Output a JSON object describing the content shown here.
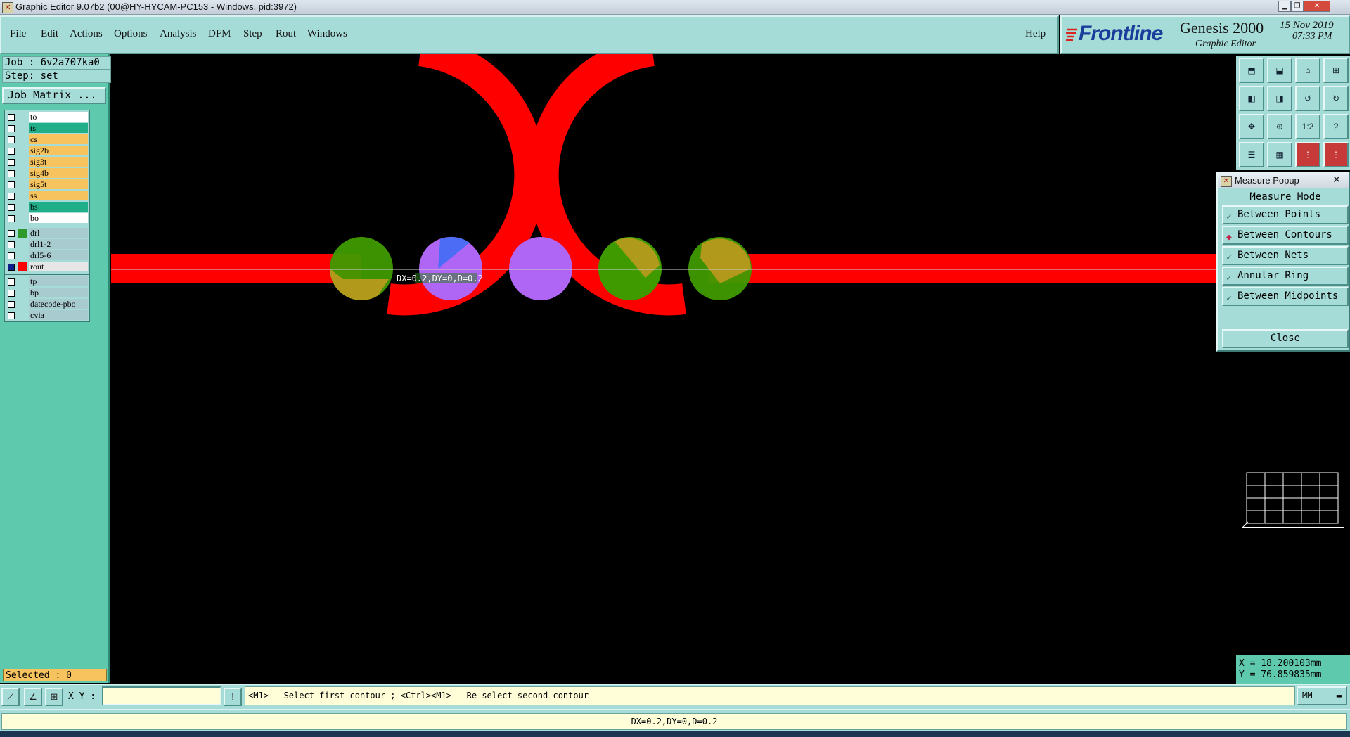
{
  "window": {
    "title": "Graphic Editor 9.07b2 (00@HY-HYCAM-PC153 - Windows, pid:3972)"
  },
  "menu": [
    "File",
    "Edit",
    "Actions",
    "Options",
    "Analysis",
    "DFM",
    "Step",
    "Rout",
    "Windows"
  ],
  "help_label": "Help",
  "brand": {
    "logo": "Frontline",
    "product": "Genesis 2000",
    "subtitle": "Graphic Editor",
    "date": "15 Nov 2019",
    "time": "07:33 PM"
  },
  "job": {
    "job_line": "Job : 6v2a707ka0",
    "step_line": "Step: set",
    "matrix_button": "Job Matrix ..."
  },
  "layers": [
    {
      "name": "to",
      "color": "#ffffff"
    },
    {
      "name": "ts",
      "color": "#1fae88"
    },
    {
      "name": "cs",
      "color": "#f7c35f"
    },
    {
      "name": "sig2b",
      "color": "#f7c35f"
    },
    {
      "name": "sig3t",
      "color": "#f7c35f"
    },
    {
      "name": "sig4b",
      "color": "#f7c35f"
    },
    {
      "name": "sig5t",
      "color": "#f7c35f"
    },
    {
      "name": "ss",
      "color": "#f7c35f"
    },
    {
      "name": "bs",
      "color": "#1fae88"
    },
    {
      "name": "bo",
      "color": "#ffffff"
    },
    {
      "name": "drl",
      "color": "#a8cbd0",
      "swatch": "#2f9a2c"
    },
    {
      "name": "drl1-2",
      "color": "#a8cbd0"
    },
    {
      "name": "drl5-6",
      "color": "#a8cbd0"
    },
    {
      "name": "rout",
      "color": "#e6e6e6",
      "swatch": "#ff0000",
      "active": true
    },
    {
      "name": "tp",
      "color": "#a8cbd0"
    },
    {
      "name": "bp",
      "color": "#a8cbd0"
    },
    {
      "name": "datecode-pbo",
      "color": "#a8cbd0"
    },
    {
      "name": "cvia",
      "color": "#a8cbd0"
    }
  ],
  "selected": "Selected : 0",
  "canvas": {
    "measure_label": "DX=0.2,DY=0,D=0.2"
  },
  "measure_popup": {
    "title": "Measure Popup",
    "header": "Measure Mode",
    "options": [
      {
        "label": "Between Points",
        "selected": false
      },
      {
        "label": "Between Contours",
        "selected": true
      },
      {
        "label": "Between Nets",
        "selected": false
      },
      {
        "label": "Annular Ring",
        "selected": false
      },
      {
        "label": "Between Midpoints",
        "selected": false
      }
    ],
    "close": "Close"
  },
  "tools": [
    "1:2",
    "?"
  ],
  "coords": {
    "x": "X = 18.200103mm",
    "y": "Y = 76.859835mm"
  },
  "command": {
    "xy_label": "X Y :",
    "xy_value": "",
    "prompt": "<M1> - Select first contour ; <Ctrl><M1> - Re-select second contour",
    "units": "MM"
  },
  "status": "DX=0.2,DY=0,D=0.2",
  "colors": {
    "trace": "#ff0000",
    "pad_green": "#3f9a00",
    "pad_purple": "#b066f5",
    "panel": "#a6dcd8",
    "left_panel": "#5fc9ad"
  }
}
